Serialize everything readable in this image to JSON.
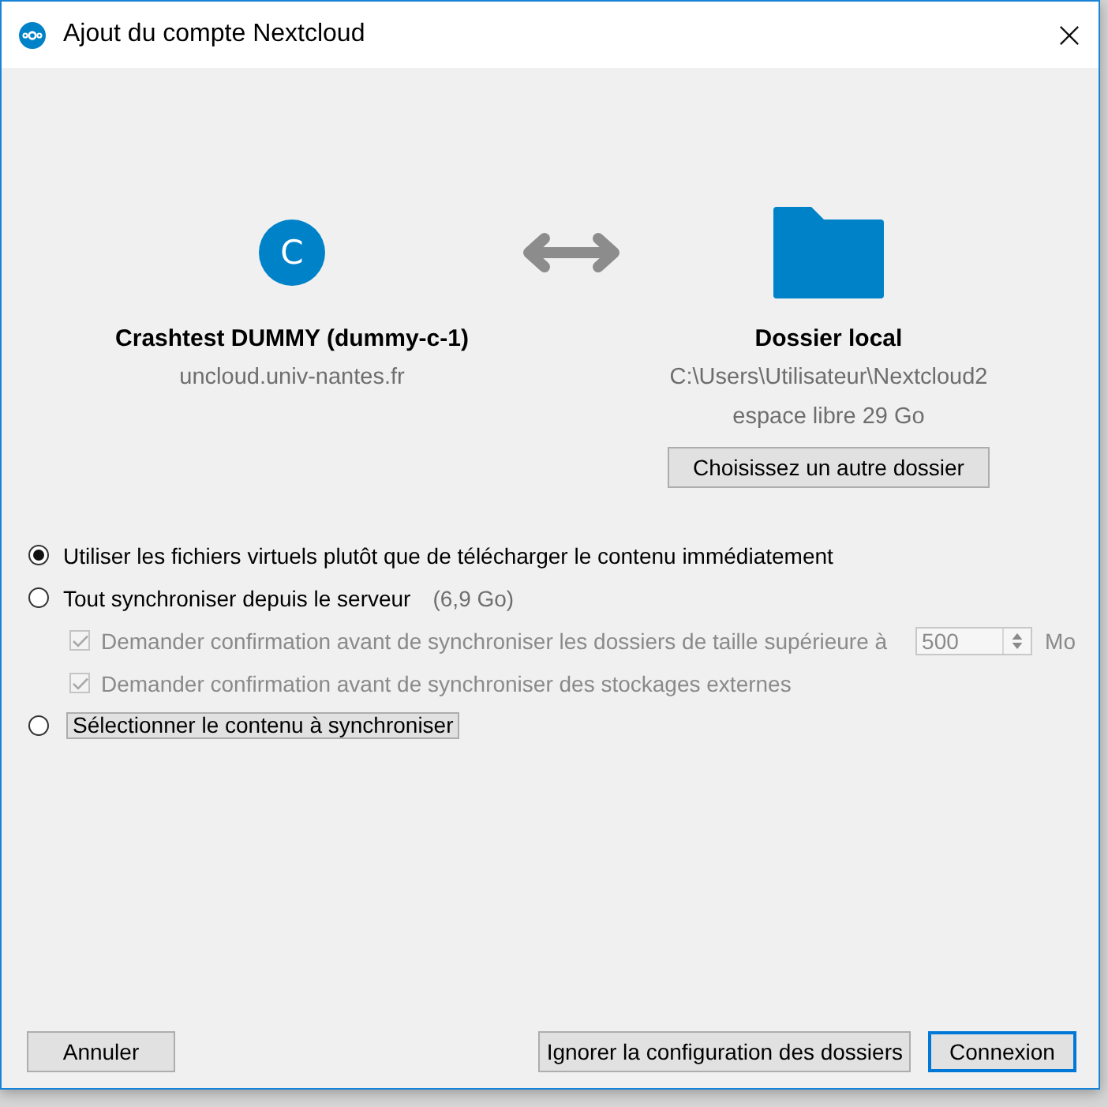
{
  "window": {
    "title": "Ajout du compte Nextcloud"
  },
  "account": {
    "avatar_letter": "C",
    "name": "Crashtest DUMMY (dummy-c-1)",
    "server": "uncloud.univ-nantes.fr"
  },
  "local_folder": {
    "title": "Dossier local",
    "path": "C:\\Users\\Utilisateur\\Nextcloud2",
    "free_space": "espace libre 29 Go",
    "button": "Choisissez un autre dossier"
  },
  "sync_options": [
    {
      "kind": "plain",
      "label": "Utiliser les fichiers virtuels plutôt que de télécharger le contenu immédiatement",
      "selected": true
    },
    {
      "kind": "plain",
      "label": "Tout synchroniser depuis le serveur",
      "size": "(6,9 Go)",
      "selected": false,
      "sub_options": [
        {
          "label": "Demander confirmation avant de synchroniser les dossiers de taille supérieure à",
          "checked": true,
          "disabled": true,
          "limit": {
            "value": "500",
            "unit": "Mo"
          }
        },
        {
          "label": "Demander confirmation avant de synchroniser des stockages externes",
          "checked": true,
          "disabled": true
        }
      ]
    },
    {
      "kind": "framed",
      "label": "Sélectionner le contenu à synchroniser",
      "selected": false
    }
  ],
  "buttons": [
    {
      "label": "Annuler",
      "default": false
    },
    {
      "label": "Ignorer la configuration des dossiers",
      "default": false
    },
    {
      "label": "Connexion",
      "default": true
    }
  ]
}
